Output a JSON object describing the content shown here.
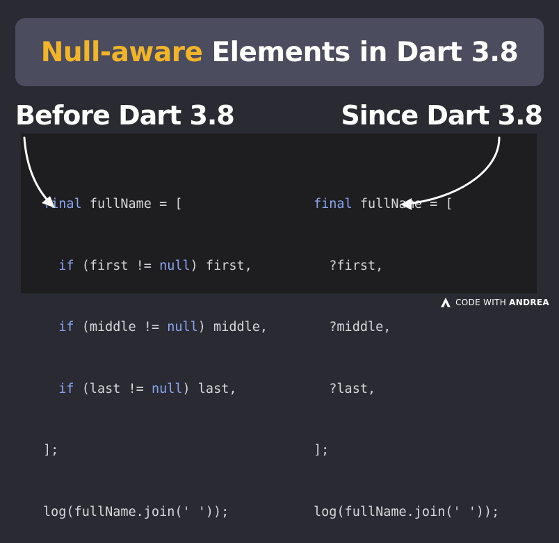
{
  "title": {
    "highlight": "Null-aware",
    "rest": " Elements in Dart 3.8"
  },
  "labels": {
    "before": "Before Dart 3.8",
    "since": "Since Dart 3.8"
  },
  "code_before": {
    "line1": {
      "kw": "final",
      "rest": " fullName = ["
    },
    "line2": {
      "indent": "  ",
      "kw1": "if",
      "mid": " (first != ",
      "kw2": "null",
      "rest": ") first,"
    },
    "line3": {
      "indent": "  ",
      "kw1": "if",
      "mid": " (middle != ",
      "kw2": "null",
      "rest": ") middle,"
    },
    "line4": {
      "indent": "  ",
      "kw1": "if",
      "mid": " (last != ",
      "kw2": "null",
      "rest": ") last,"
    },
    "line5": "];",
    "line6": "log(fullName.join(' '));"
  },
  "code_after": {
    "line1": {
      "kw": "final",
      "rest": " fullName = ["
    },
    "line2": "  ?first,",
    "line3": "  ?middle,",
    "line4": "  ?last,",
    "line5": "];",
    "line6": "log(fullName.join(' '));"
  },
  "brand": {
    "logo_icon": "code-with-andrea-logo",
    "name_part1": "CODE WITH ",
    "name_part2": "ANDREA"
  },
  "colors": {
    "background": "#2a2b32",
    "banner": "#4b4d5f",
    "highlight": "#f2b52a",
    "keyword": "#8ba4f0",
    "code_panel": "#1e1e21",
    "code_text": "#d7d7da"
  }
}
